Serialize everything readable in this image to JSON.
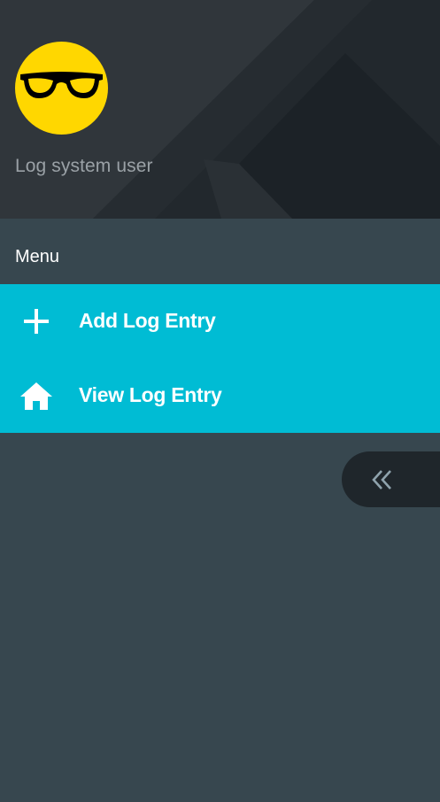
{
  "user": {
    "name": "Log system user",
    "avatar_icon": "glasses-emoji-avatar"
  },
  "menu": {
    "heading": "Menu",
    "items": [
      {
        "label": "Add Log Entry",
        "icon": "plus-icon"
      },
      {
        "label": "View Log Entry",
        "icon": "home-icon"
      }
    ]
  },
  "collapse": {
    "icon": "chevrons-left-icon"
  },
  "colors": {
    "sidebar_bg": "#37474f",
    "header_bg": "#2c3237",
    "accent": "#00bcd4",
    "avatar": "#ffd700",
    "collapse_bg": "#1f262b"
  }
}
